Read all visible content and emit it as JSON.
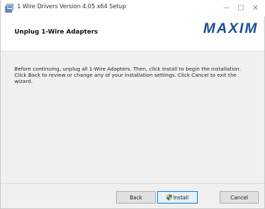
{
  "window": {
    "title": "1 Wire Drivers Version 4.05 x64 Setup",
    "controls": {
      "minimize": "—",
      "maximize": "□",
      "close": "✕"
    }
  },
  "header": {
    "title": "Unplug 1-Wire Adapters",
    "logo_text": "MAXIM"
  },
  "content": {
    "message": "Before continuing, unplug all 1-Wire Adapters. Then, click Install to begin the installation. Click Back to review or change any of your installation settings. Click Cancel to exit the wizard."
  },
  "buttons": {
    "back": "Back",
    "install": "Install",
    "cancel": "Cancel"
  },
  "colors": {
    "brand_logo": "#1d4f91",
    "window_bg": "#f0f0f0",
    "focused_button_border": "#0078d7"
  },
  "icons": {
    "app": "installer-app-icon",
    "install_button": "uac-shield-icon"
  }
}
